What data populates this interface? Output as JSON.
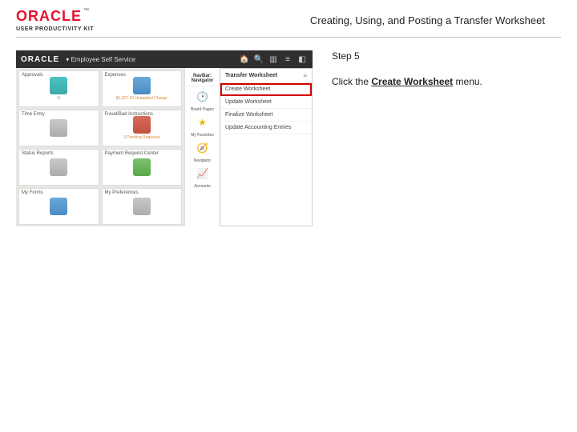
{
  "header": {
    "brand": "ORACLE",
    "tm": "™",
    "upk": "USER PRODUCTIVITY KIT",
    "title": "Creating, Using, and Posting a Transfer Worksheet"
  },
  "instructions": {
    "step_label": "Step 5",
    "line_pre": "Click the ",
    "line_bold": "Create Worksheet",
    "line_post": " menu."
  },
  "screenshot": {
    "topbar": {
      "brand": "ORACLE",
      "context": "▾ Employee Self Service"
    },
    "tiles": [
      {
        "label": "Approvals",
        "sub": "11",
        "icon": "teal"
      },
      {
        "label": "Expenses",
        "sub": "$1,027.20 Unapplied Charge",
        "icon": "blue"
      },
      {
        "label": "Time Entry",
        "sub": "",
        "icon": "grey"
      },
      {
        "label": "Fraud/Bad Instructions",
        "sub": "3  Pending Requests",
        "icon": "red"
      },
      {
        "label": "Status Reports",
        "sub": "",
        "icon": "grey"
      },
      {
        "label": "Payment Request Center",
        "sub": "",
        "icon": "green"
      },
      {
        "label": "My Forms",
        "sub": "",
        "icon": "blue"
      },
      {
        "label": "My Preferences",
        "sub": "",
        "icon": "grey"
      }
    ],
    "navbar_header": "NavBar: Navigator",
    "rail": [
      {
        "label": "Board Pages",
        "glyph": "🕑"
      },
      {
        "label": "My Favorites",
        "glyph": "★"
      },
      {
        "label": "Navigator",
        "glyph": "🧭"
      },
      {
        "label": "Accounts",
        "glyph": "📈"
      }
    ],
    "flyout": {
      "title": "Transfer Worksheet",
      "close": "≡",
      "items": [
        "Create Worksheet",
        "Update Worksheet",
        "Finalize Worksheet",
        "Update Accounting Entries"
      ],
      "highlight_index": 0
    }
  }
}
